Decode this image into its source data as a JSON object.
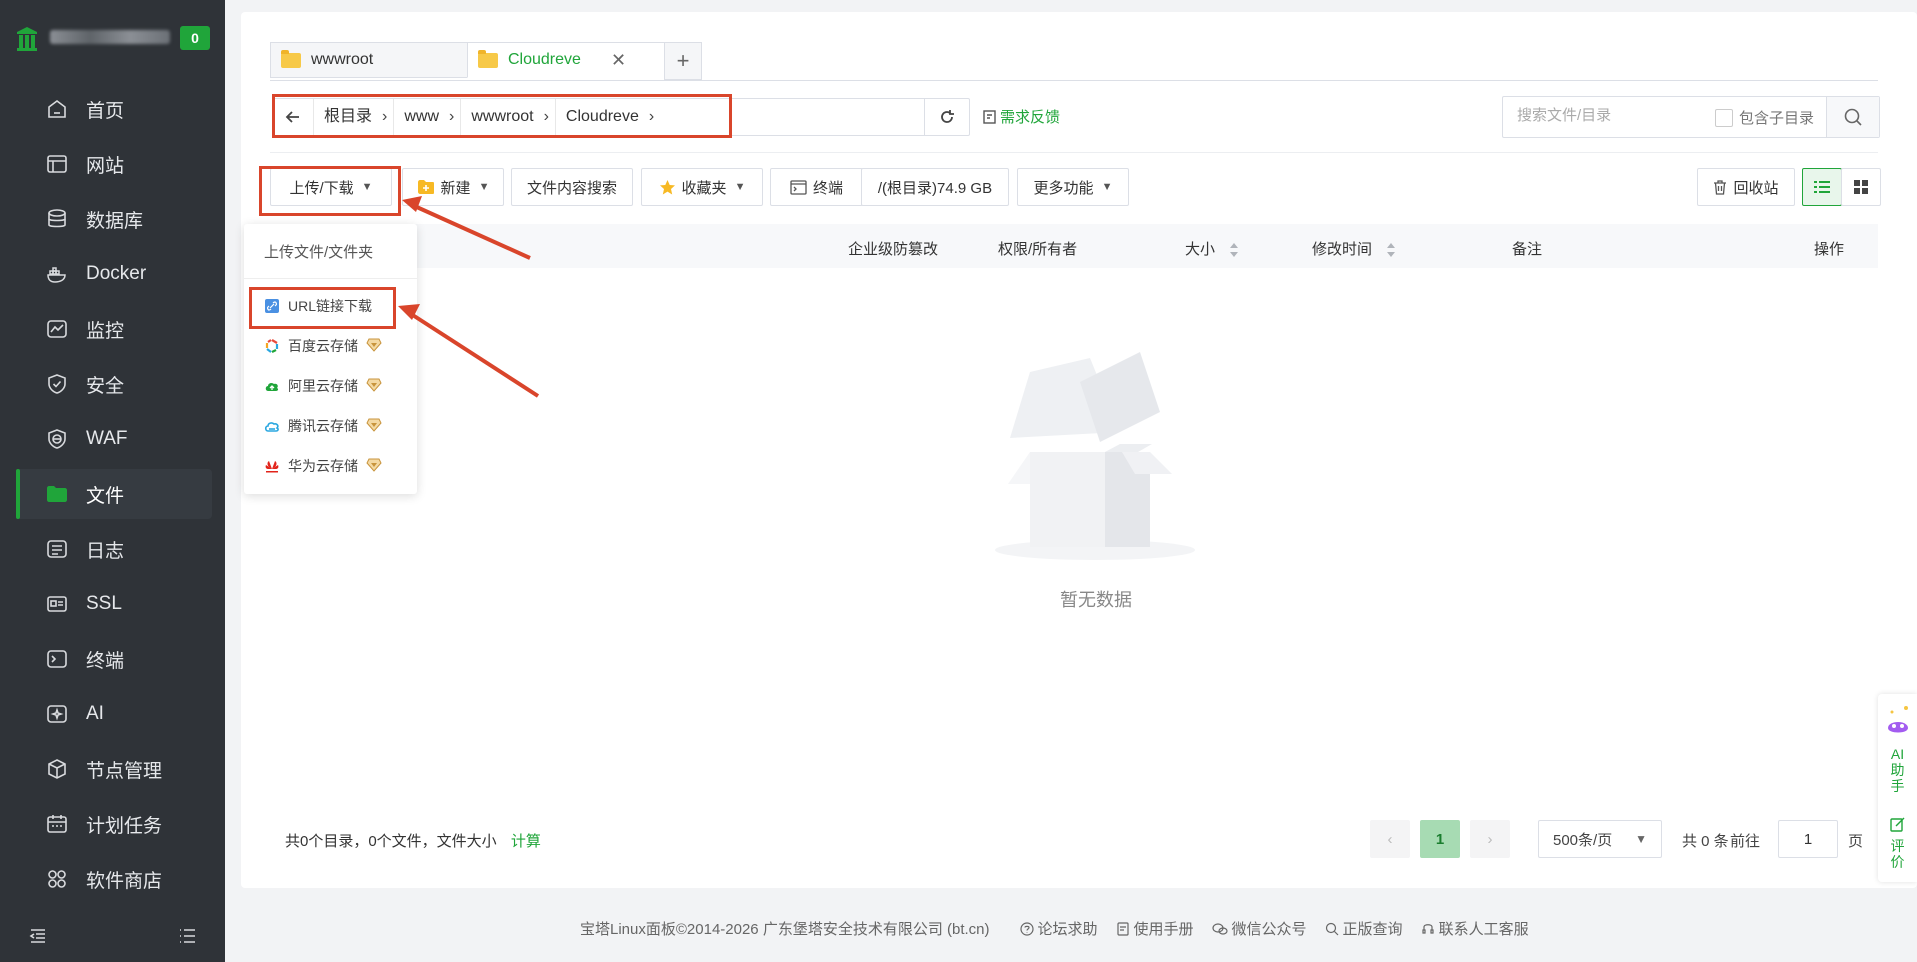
{
  "sidebar": {
    "badge": "0",
    "items": [
      {
        "label": "首页",
        "icon": "home-icon"
      },
      {
        "label": "网站",
        "icon": "website-icon"
      },
      {
        "label": "数据库",
        "icon": "database-icon"
      },
      {
        "label": "Docker",
        "icon": "docker-icon"
      },
      {
        "label": "监控",
        "icon": "monitor-icon"
      },
      {
        "label": "安全",
        "icon": "shield-icon"
      },
      {
        "label": "WAF",
        "icon": "waf-icon"
      },
      {
        "label": "文件",
        "icon": "folder-icon"
      },
      {
        "label": "日志",
        "icon": "log-icon"
      },
      {
        "label": "SSL",
        "icon": "ssl-icon"
      },
      {
        "label": "终端",
        "icon": "terminal-icon"
      },
      {
        "label": "AI",
        "icon": "ai-icon"
      },
      {
        "label": "节点管理",
        "icon": "node-icon"
      },
      {
        "label": "计划任务",
        "icon": "calendar-icon"
      },
      {
        "label": "软件商店",
        "icon": "store-icon"
      }
    ]
  },
  "tabs": [
    {
      "label": "wwwroot",
      "active": false
    },
    {
      "label": "Cloudreve",
      "active": true
    }
  ],
  "tab_close": "✕",
  "tab_add": "+",
  "path": {
    "crumbs": [
      "根目录",
      "www",
      "wwwroot",
      "Cloudreve"
    ],
    "feedback": "需求反馈"
  },
  "search": {
    "placeholder": "搜索文件/目录",
    "include_sub": "包含子目录"
  },
  "toolbar": {
    "upload": "上传/下载",
    "new": "新建",
    "content_search": "文件内容搜索",
    "favorites": "收藏夹",
    "terminal": "终端",
    "disk": "/(根目录)74.9 GB",
    "more": "更多功能",
    "recycle": "回收站"
  },
  "table": {
    "headers": [
      "企业级防篡改",
      "权限/所有者",
      "大小",
      "修改时间",
      "备注",
      "操作"
    ]
  },
  "dropdown": {
    "header": "上传文件/文件夹",
    "items": [
      "URL链接下载",
      "百度云存储",
      "阿里云存储",
      "腾讯云存储",
      "华为云存储"
    ]
  },
  "empty": "暂无数据",
  "stats": {
    "text": "共0个目录，0个文件，文件大小",
    "calc": "计算"
  },
  "pagination": {
    "current": "1",
    "size": "500条/页",
    "total": "共 0 条",
    "goto": "前往",
    "goto_value": "1",
    "page_unit": "页"
  },
  "ai_float": {
    "assistant": [
      "AI",
      "助",
      "手"
    ],
    "review": [
      "评",
      "价"
    ]
  },
  "footer": {
    "copyright": "宝塔Linux面板©2014-2026 广东堡塔安全技术有限公司 (bt.cn)",
    "links": [
      "论坛求助",
      "使用手册",
      "微信公众号",
      "正版查询",
      "联系人工客服"
    ]
  },
  "colors": {
    "accent": "#20a53a",
    "sidebar_bg": "#2f3338",
    "annotation": "#d9452b"
  }
}
